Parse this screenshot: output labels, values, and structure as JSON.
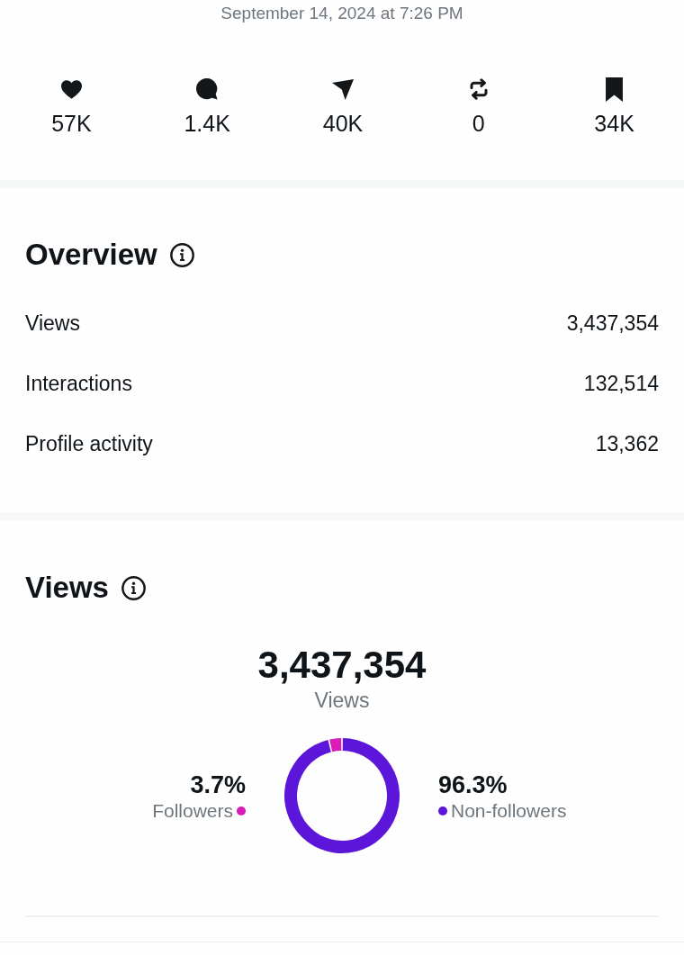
{
  "timestamp": "September 14, 2024 at 7:26 PM",
  "engagement": [
    {
      "kind": "likes",
      "count": "57K"
    },
    {
      "kind": "replies",
      "count": "1.4K"
    },
    {
      "kind": "shares",
      "count": "40K"
    },
    {
      "kind": "reposts",
      "count": "0"
    },
    {
      "kind": "bookmarks",
      "count": "34K"
    }
  ],
  "overview": {
    "title": "Overview",
    "rows": [
      {
        "label": "Views",
        "value": "3,437,354"
      },
      {
        "label": "Interactions",
        "value": "132,514"
      },
      {
        "label": "Profile activity",
        "value": "13,362"
      }
    ]
  },
  "views": {
    "title": "Views",
    "total": "3,437,354",
    "total_label": "Views",
    "legend": [
      {
        "percent": "3.7%",
        "color": "#d91cb6"
      },
      {
        "percent": "96.3%",
        "color": "#5b16d9"
      }
    ],
    "chart_data": {
      "type": "donut",
      "categories": [
        "Followers",
        "Non-followers"
      ],
      "values": [
        3.7,
        96.3
      ]
    }
  }
}
